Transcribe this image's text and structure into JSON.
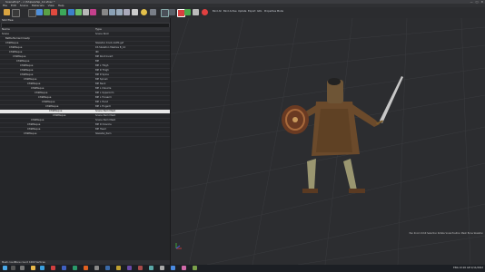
{
  "window": {
    "title": "SceneExp* - c:\\Ships\\ship_12.sfxsc *",
    "controls": [
      "—",
      "□",
      "✕"
    ]
  },
  "menu": [
    "File",
    "Edit",
    "Scene",
    "Materials",
    "View",
    "Help"
  ],
  "toolbar_labels": [
    "Bind All",
    "Bind Active",
    "Update",
    "Export",
    "GDL",
    "Properties Mode"
  ],
  "scene_panel": {
    "title": "SkinTree",
    "columns": [
      "Name",
      "Type"
    ],
    "rows": [
      {
        "name": "Scene",
        "type": "Scene Root",
        "indent": 0
      },
      {
        "name": "BattleHumanCrowdp",
        "type": "",
        "indent": 1
      },
      {
        "name": "Ch9Pilsque",
        "type": "Skeleton Knob AAPK.gsf",
        "indent": 1
      },
      {
        "name": "Ch9Pilsque",
        "type": "KS Skeleton Meshes B_12",
        "indent": 2
      },
      {
        "name": "Ch9Pilsque",
        "type": "IIN",
        "indent": 2
      },
      {
        "name": "Ch9Pilsque",
        "type": "BIP Root Invert",
        "indent": 3
      },
      {
        "name": "Ch9Pilsque",
        "type": "BIP",
        "indent": 4
      },
      {
        "name": "Ch9Pilsque",
        "type": "BIP L Thigh",
        "indent": 5
      },
      {
        "name": "Ch9Pilsque",
        "type": "BIP R Thigh",
        "indent": 5
      },
      {
        "name": "Ch9Pilsque",
        "type": "BIP R Spine",
        "indent": 5
      },
      {
        "name": "Ch9Pilsque",
        "type": "BIP Spine1",
        "indent": 6
      },
      {
        "name": "Ch9Pilsque",
        "type": "BIP Neck",
        "indent": 7
      },
      {
        "name": "Ch9Pilsque",
        "type": "BIP L Clavicle",
        "indent": 8
      },
      {
        "name": "Ch9Pilsque",
        "type": "BIP L UpperArm",
        "indent": 9
      },
      {
        "name": "Ch9Pilsque",
        "type": "BIP L Forearm",
        "indent": 10
      },
      {
        "name": "Ch9Pilsque",
        "type": "BIP L Hand",
        "indent": 11
      },
      {
        "name": "Ch9Pilsque",
        "type": "BIP L Finger0",
        "indent": 12
      },
      {
        "name": "Ch9Pilsque",
        "type": "Scene Item Mesh",
        "indent": 13,
        "selected": true
      },
      {
        "name": "Ch9Pilsque",
        "type": "Scene Item Mesh",
        "indent": 14
      },
      {
        "name": "Ch9Pilsque",
        "type": "Scene Item Mesh",
        "indent": 8
      },
      {
        "name": "Ch9Pilsque",
        "type": "BIP R Clavicle",
        "indent": 7
      },
      {
        "name": "Ch9Pilsque",
        "type": "BIP Head",
        "indent": 7
      },
      {
        "name": "Ch9Pilsque",
        "type": "Skeletal_Item",
        "indent": 6
      }
    ],
    "status": [
      "Mesh count",
      "Bone count",
      "1000 Vertices"
    ]
  },
  "viewport_status": "Pan  Zoom  Orbit  Selection  Rotate  Scale  Position  Mesh  Bone  Skeleton",
  "taskbar": {
    "time": "10:26 AM",
    "date": "2/11/2022",
    "lang": "ENG"
  }
}
